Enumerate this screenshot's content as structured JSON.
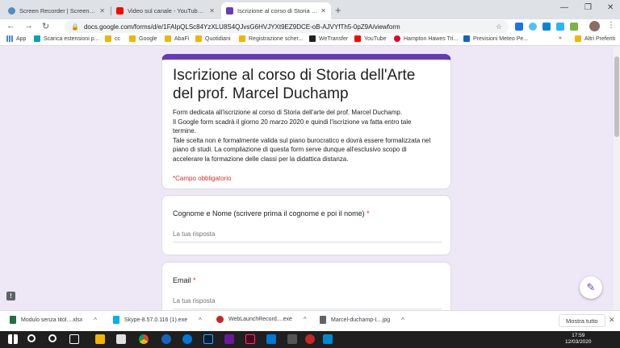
{
  "tabs": [
    {
      "title": "Screen Recorder | Screencast-O-Matic",
      "favicon": "screencast-icon",
      "color": "#4f8fc0"
    },
    {
      "title": "Video sul canale - YouTube Studio",
      "favicon": "youtube-icon",
      "color": "#ff0000"
    },
    {
      "title": "Iscrizione al corso di Storia dell'Arte del prof. Marcel Duchamp",
      "favicon": "google-forms-icon",
      "color": "#673ab7"
    }
  ],
  "new_tab": "+",
  "window_controls": {
    "minimize": "—",
    "maximize": "❐",
    "close": "✕"
  },
  "toolbar": {
    "back": "←",
    "forward": "→",
    "reload": "↻",
    "menu": "⋮"
  },
  "address_bar": {
    "url": "docs.google.com/forms/d/e/1FAIpQLSc84YzXLU8S4QJvsG6HVJYXt9EZ9DCE-oB-AJVYfTh5-0pZ9A/viewform",
    "lock_icon": "🔒",
    "star_icon": "☆"
  },
  "bookmarks": {
    "apps_label": "App",
    "items": [
      {
        "label": "Scarica estensioni p...",
        "icon": "extension-icon",
        "color": "#00a3b4"
      },
      {
        "label": "cc",
        "icon": "folder-icon",
        "color": "#f4b400"
      },
      {
        "label": "Google",
        "icon": "folder-icon",
        "color": "#f4b400"
      },
      {
        "label": "AbaFi",
        "icon": "folder-icon",
        "color": "#f4b400"
      },
      {
        "label": "Quotidiani",
        "icon": "folder-icon",
        "color": "#f4b400"
      },
      {
        "label": "Registrazione scher...",
        "icon": "folder-icon",
        "color": "#f4b400"
      },
      {
        "label": "WeTransfer",
        "icon": "wetransfer-icon",
        "color": "#202124"
      },
      {
        "label": "YouTube",
        "icon": "youtube-icon",
        "color": "#ff0000"
      },
      {
        "label": "Hampton Hawes Tri...",
        "icon": "pinterest-icon",
        "color": "#e60023"
      },
      {
        "label": "Previsioni Meteo Pe...",
        "icon": "meteo-icon",
        "color": "#1565c0"
      }
    ],
    "more": "»",
    "other_label": "Altri Preferiti"
  },
  "form": {
    "title": "Iscrizione al corso di Storia dell'Arte del prof. Marcel Duchamp",
    "description_lines": [
      "Form dedicata all'iscrizione al corso di Storia dell'arte del prof. Marcel Duchamp.",
      "Il Google form scadrà il giorno 20 marzo 2020 e quindi l'iscrizione va fatta entro tale",
      "termine.",
      "Tale scelta non è formalmente valida sul piano burocratico e dovrà essere formalizzata nel",
      "piano di studi. La compilazione di questa form serve dunque all'esclusivo scopo di",
      "accelerare la formazione delle classi per la didattica distanza."
    ],
    "required_note": "*Campo obbligatorio",
    "questions": [
      {
        "label": "Cognome e Nome (scrivere prima il cognome e poi il nome)",
        "required_mark": "*",
        "placeholder": "La tua risposta"
      },
      {
        "label": "Email",
        "required_mark": "*",
        "placeholder": "La tua risposta"
      }
    ],
    "accent_color": "#673ab7"
  },
  "feedback_icon": "!",
  "edit_fab_icon": "✎",
  "downloads": {
    "items": [
      {
        "name": "Modulo senza titol....xlsx",
        "icon": "excel-icon",
        "color": "#1e7145"
      },
      {
        "name": "Skype-8.57.0.116 (1).exe",
        "icon": "skype-installer-icon",
        "color": "#00aff0"
      },
      {
        "name": "WebLaunchRecord....exe",
        "icon": "screencast-icon",
        "color": "#c62828"
      },
      {
        "name": "Marcel-duchamp-l....jpg",
        "icon": "image-file-icon",
        "color": "#5f6368"
      }
    ],
    "chevron": "^",
    "show_all": "Mostra tutto",
    "close": "✕"
  },
  "taskbar": {
    "time": "17:59",
    "date": "12/03/2020",
    "icons": [
      "windows-start-icon",
      "search-icon",
      "cortana-icon",
      "task-view-icon",
      "file-explorer-icon",
      "mail-icon",
      "chrome-icon",
      "firefox-icon",
      "edge-icon",
      "photoshop-icon",
      "app-icon",
      "indesign-icon",
      "app-icon",
      "app-icon",
      "app-icon",
      "app-icon"
    ]
  }
}
